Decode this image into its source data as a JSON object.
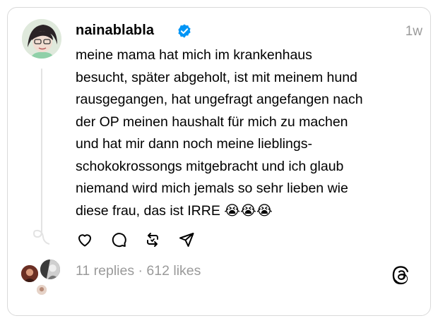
{
  "post": {
    "username": "nainablabla",
    "verified": true,
    "timestamp": "1w",
    "text": "meine mama hat mich im krankenhaus\nbesucht, später abgeholt, ist mit meinem hund\nrausgegangen, hat ungefragt angefangen nach\nder OP meinen haushalt für mich zu machen\nund hat mir dann noch meine lieblings-\nschokokrossongs mitgebracht und ich glaub\nniemand wird mich jemals so sehr lieben wie\ndiese frau, das ist IRRE 😭😭😭"
  },
  "actions": {
    "like_icon": "heart-icon",
    "reply_icon": "comment-icon",
    "repost_icon": "repost-icon",
    "share_icon": "share-icon"
  },
  "footer": {
    "stats": "11 replies · 612 likes",
    "logo_icon": "threads-logo-icon"
  },
  "colors": {
    "text": "#000000",
    "muted": "#9a9a9a",
    "verified": "#0095f6",
    "border": "#d9d9d9"
  }
}
